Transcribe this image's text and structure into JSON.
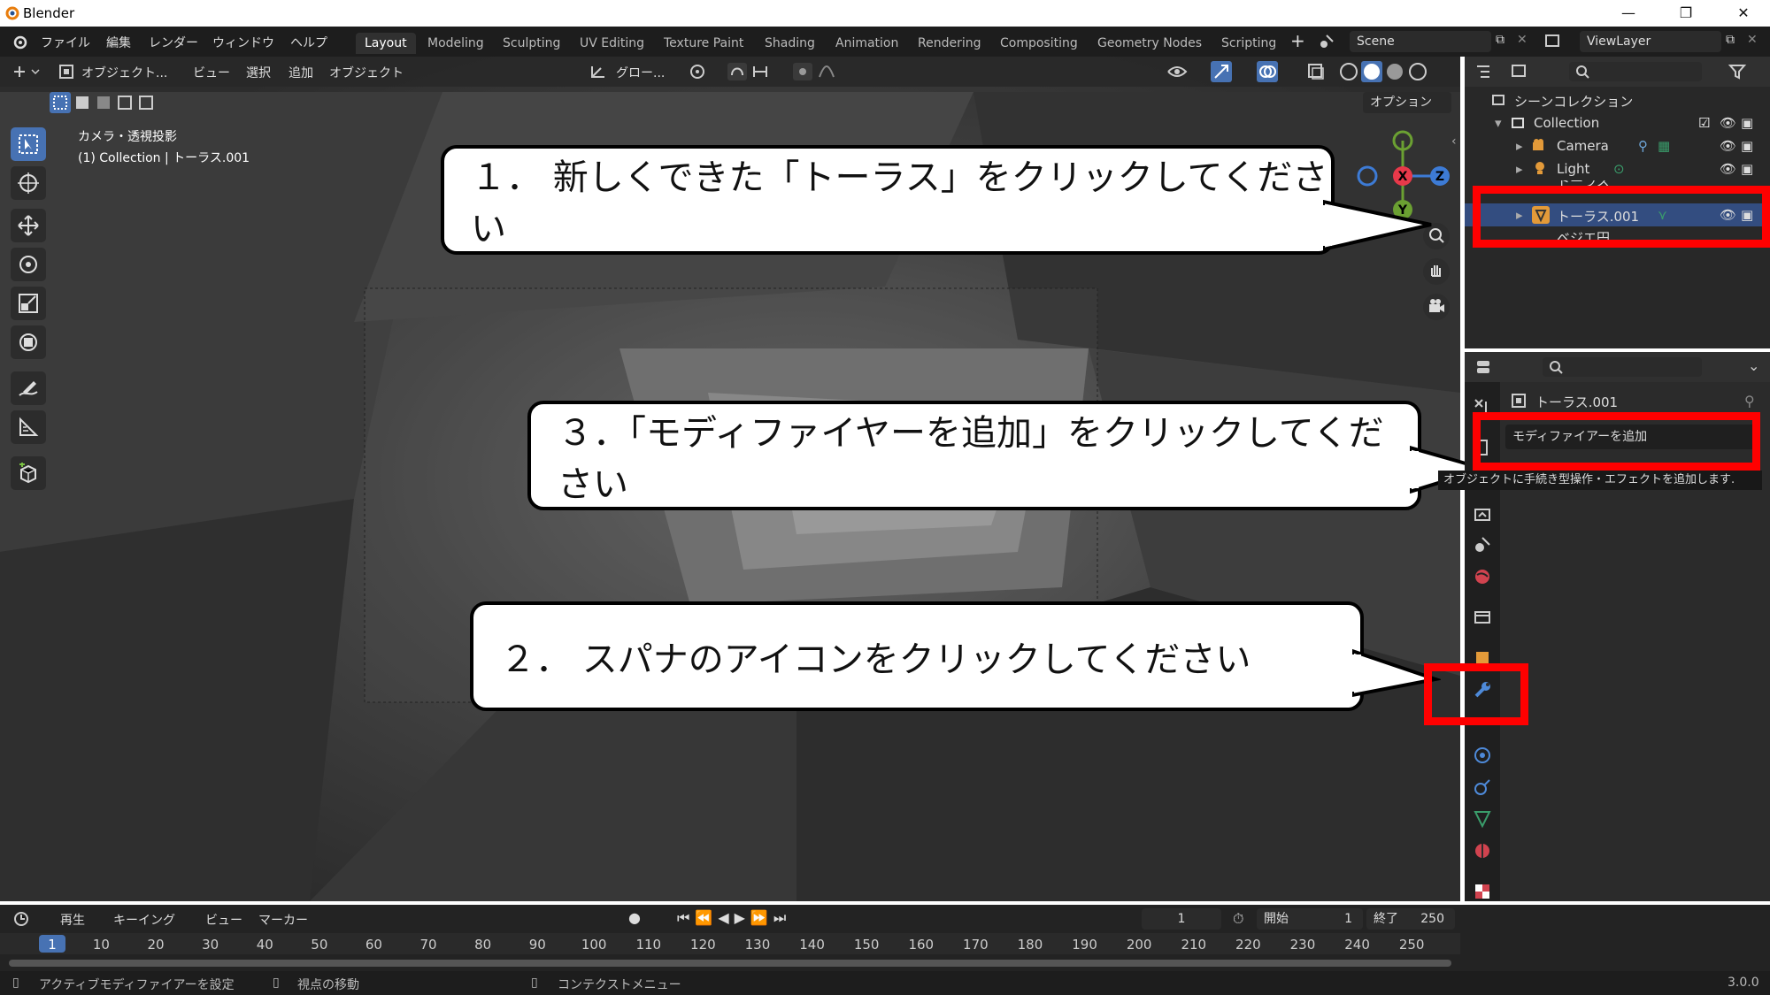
{
  "window": {
    "title": "Blender",
    "minimize": "—",
    "maximize": "❐",
    "close": "✕"
  },
  "menu": [
    "ファイル",
    "編集",
    "レンダー",
    "ウィンドウ",
    "ヘルプ"
  ],
  "workspaces": [
    "Layout",
    "Modeling",
    "Sculpting",
    "UV Editing",
    "Texture Paint",
    "Shading",
    "Animation",
    "Rendering",
    "Compositing",
    "Geometry Nodes",
    "Scripting"
  ],
  "scene": "Scene",
  "viewlayer": "ViewLayer",
  "viewport": {
    "mode": "オブジェクト...",
    "menus": [
      "ビュー",
      "選択",
      "追加",
      "オブジェクト"
    ],
    "transform": "グロー...",
    "options": "オプション",
    "camera_label": "カメラ・透視投影",
    "collection_label": "(1) Collection | トーラス.001"
  },
  "outliner": {
    "scene_collection": "シーンコレクション",
    "collection": "Collection",
    "items": [
      "Camera",
      "Light",
      "トーラス",
      "トーラス.001",
      "ベジエ円"
    ]
  },
  "properties": {
    "object_name": "トーラス.001",
    "add_modifier": "モディファイアーを追加",
    "tooltip": "オブジェクトに手続き型操作・エフェクトを追加します."
  },
  "callouts": {
    "step1": "１． 新しくできた「トーラス」をクリックしてください",
    "step2": "２． スパナのアイコンをクリックしてください",
    "step3": "３．「モディファイヤーを追加」をクリックしてください"
  },
  "timeline": {
    "menus": [
      "再生",
      "キーイング",
      "ビュー",
      "マーカー"
    ],
    "current_frame": "1",
    "start_label": "開始",
    "start": "1",
    "end_label": "終了",
    "end": "250",
    "frames": [
      "1",
      "10",
      "20",
      "30",
      "40",
      "50",
      "60",
      "70",
      "80",
      "90",
      "100",
      "110",
      "120",
      "130",
      "140",
      "150",
      "160",
      "170",
      "180",
      "190",
      "200",
      "210",
      "220",
      "230",
      "240",
      "250"
    ]
  },
  "status": {
    "left": "アクティブモディファイアーを設定",
    "middle": "視点の移動",
    "right": "コンテクストメニュー",
    "version": "3.0.0"
  },
  "colors": {
    "accent": "#4772b3",
    "highlight": "#ff0000",
    "axis_x": "#e8394a",
    "axis_y": "#6ba032",
    "axis_z": "#3d7bd5"
  }
}
